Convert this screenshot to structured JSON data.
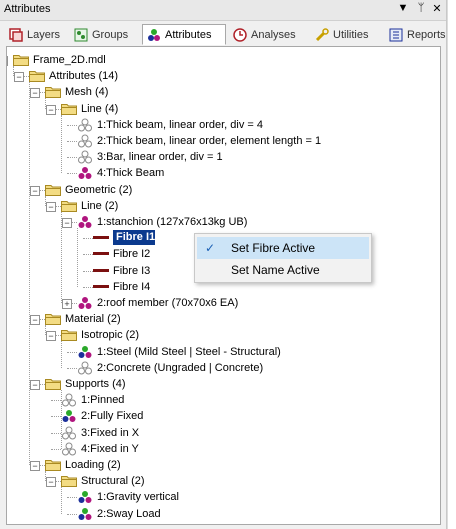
{
  "window": {
    "title": "Attributes",
    "dropdown_icon": "▼",
    "pin_icon": "ᛘ",
    "close_icon": "✕"
  },
  "tabs": [
    {
      "label": "Layers",
      "icon": "layers-icon"
    },
    {
      "label": "Groups",
      "icon": "groups-icon"
    },
    {
      "label": "Attributes",
      "icon": "attributes-icon",
      "active": true
    },
    {
      "label": "Analyses",
      "icon": "analyses-icon"
    },
    {
      "label": "Utilities",
      "icon": "utilities-icon"
    },
    {
      "label": "Reports",
      "icon": "reports-icon"
    }
  ],
  "tree": {
    "root": "Frame_2D.mdl",
    "attributes": "Attributes (14)",
    "mesh": "Mesh (4)",
    "mesh_line": "Line (4)",
    "mesh_items": [
      "1:Thick beam, linear order, div = 4",
      "2:Thick beam, linear order, element length = 1",
      "3:Bar, linear order, div = 1",
      "4:Thick Beam"
    ],
    "geometric": "Geometric (2)",
    "geo_line": "Line (2)",
    "stanchion": "1:stanchion (127x76x13kg UB)",
    "fibres": [
      "Fibre I1",
      "Fibre I2",
      "Fibre I3",
      "Fibre I4"
    ],
    "roof_member": "2:roof member (70x70x6 EA)",
    "material": "Material (2)",
    "isotropic": "Isotropic (2)",
    "material_items": [
      "1:Steel (Mild Steel | Steel - Structural)",
      "2:Concrete (Ungraded | Concrete)"
    ],
    "supports": "Supports (4)",
    "supports_items": [
      "1:Pinned",
      "2:Fully Fixed",
      "3:Fixed in X",
      "4:Fixed in Y"
    ],
    "loading": "Loading (2)",
    "structural": "Structural (2)",
    "loading_items": [
      "1:Gravity vertical",
      "2:Sway Load"
    ]
  },
  "context_menu": {
    "items": [
      {
        "label": "Set Fibre Active",
        "checked": true
      },
      {
        "label": "Set Name Active",
        "checked": false
      }
    ],
    "check_glyph": "✓"
  },
  "colors": {
    "accent": "#0b3a8e",
    "menu_highlight": "#cce4f7",
    "fibre": "#7b1010",
    "folder": "#e6c65a"
  }
}
